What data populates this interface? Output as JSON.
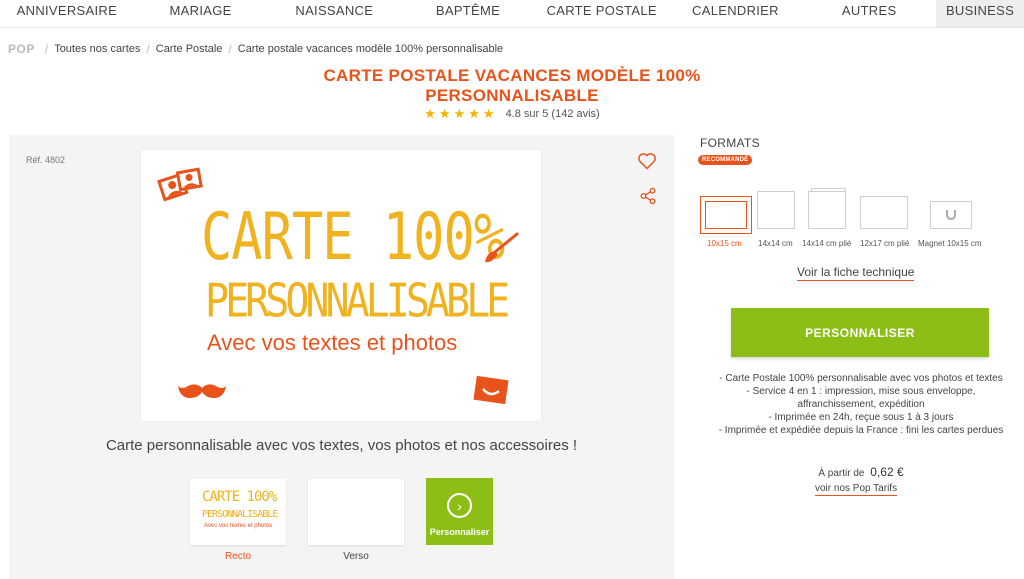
{
  "nav": {
    "items": [
      "ANNIVERSAIRE",
      "MARIAGE",
      "NAISSANCE",
      "BAPTÊME",
      "CARTE POSTALE",
      "CALENDRIER",
      "AUTRES"
    ],
    "business": "BUSINESS"
  },
  "breadcrumb": {
    "logo": "POP",
    "items": [
      "Toutes nos cartes",
      "Carte Postale",
      "Carte postale vacances modèle 100% personnalisable"
    ]
  },
  "product": {
    "title_line1": "CARTE POSTALE VACANCES MODÈLE 100%",
    "title_line2": "PERSONNALISABLE",
    "stars": "★★★★★",
    "rating_text": "4.8 sur 5 (142 avis)",
    "ref": "Réf. 4802",
    "card_line1": "CARTE 100%",
    "card_line2": "PERSONNALISABLE",
    "card_line3": "Avec vos textes et photos",
    "caption": "Carte personnalisable avec vos textes, vos photos et nos accessoires !",
    "thumb_recto_label": "Recto",
    "thumb_verso_label": "Verso",
    "thumb_perso_label": "Personnaliser",
    "thumb_mini1": "CARTE 100%",
    "thumb_mini2": "PERSONNALISABLE",
    "thumb_mini3": "Avec vos textes et photos"
  },
  "formats": {
    "title": "FORMATS",
    "badge": "RECOMMANDÉ",
    "options": [
      "10x15 cm",
      "14x14 cm",
      "14x14 cm plié",
      "12x17 cm plié",
      "Magnet 10x15 cm"
    ],
    "fiche_link": "Voir la fiche technique"
  },
  "cta": {
    "label": "PERSONNALISER"
  },
  "bullets": [
    "- Carte Postale 100% personnalisable avec vos photos et textes",
    "- Service 4 en 1 : impression, mise sous enveloppe,",
    "affranchissement, expédition",
    "- Imprimée en 24h, reçue sous 1 à 3 jours",
    "- Imprimée et expédiée depuis la France : fini les cartes perdues"
  ],
  "price": {
    "prefix": "À partir de",
    "amount": "0,62 €",
    "tarifs_link": "voir nos Pop Tarifs"
  },
  "colors": {
    "accent": "#e8531b",
    "green": "#8cbe16",
    "yellow": "#f0b21e"
  }
}
